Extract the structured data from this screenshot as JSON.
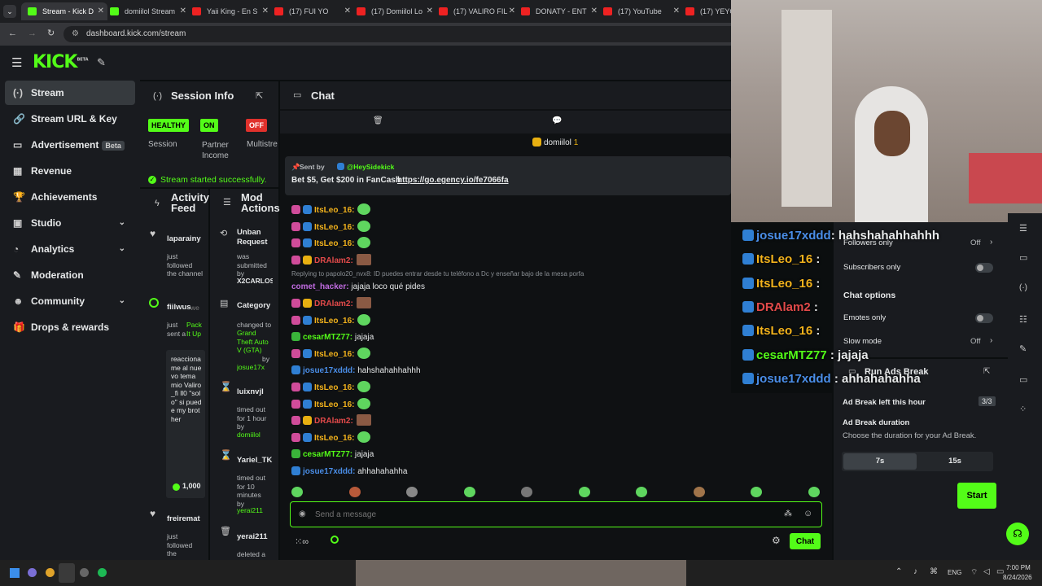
{
  "browser": {
    "tabs": [
      {
        "label": "Stream - Kick D",
        "color": "#53fc18"
      },
      {
        "label": "domiilol Stream",
        "color": "#53fc18"
      },
      {
        "label": "Yaii King - En S",
        "color": "#e22"
      },
      {
        "label": "(17) FUI YO",
        "color": "#e22"
      },
      {
        "label": "(17) Domiilol Lo",
        "color": "#e22"
      },
      {
        "label": "(17) VALIRO FIL",
        "color": "#e22"
      },
      {
        "label": "DONATY - ENT",
        "color": "#e22"
      },
      {
        "label": "(17) YouTube",
        "color": "#e22"
      },
      {
        "label": "(17) YEYO",
        "color": "#e22"
      }
    ],
    "url": "dashboard.kick.com/stream"
  },
  "brand": {
    "logo": "KICK",
    "beta": "BETA"
  },
  "nav": {
    "items": [
      {
        "label": "Stream",
        "icon": "signal-icon"
      },
      {
        "label": "Stream URL & Key",
        "icon": "link-icon"
      },
      {
        "label": "Advertisement",
        "icon": "ad-icon"
      },
      {
        "label": "Revenue",
        "icon": "dollar-icon"
      },
      {
        "label": "Achievements",
        "icon": "trophy-icon"
      },
      {
        "label": "Studio",
        "icon": "studio-icon"
      },
      {
        "label": "Analytics",
        "icon": "chart-icon"
      },
      {
        "label": "Moderation",
        "icon": "wrench-icon"
      },
      {
        "label": "Community",
        "icon": "people-icon"
      },
      {
        "label": "Drops & rewards",
        "icon": "gift-icon"
      }
    ],
    "beta_badge": "Beta"
  },
  "session": {
    "title": "Session Info",
    "pills": [
      {
        "text": "HEALTHY",
        "color": "#53fc18",
        "label": "Session"
      },
      {
        "text": "ON",
        "color": "#53fc18",
        "label": "Partner Income"
      },
      {
        "text": "OFF",
        "color": "#e0312c",
        "label": "Multistre"
      }
    ],
    "status": "Stream started successfully."
  },
  "activity": {
    "title": "Activity Feed",
    "items": [
      {
        "user": "laparainy",
        "text": "just followed the channel"
      },
      {
        "user": "fiilwus",
        "suffix": "we",
        "text": "just sent a",
        "pack": "Pack It Up",
        "quote": "reacciona me al nuevo tema mio Valiro_fi ll0 \"solo\" si puede my brother",
        "amount": "1,000"
      },
      {
        "user": "freiremat",
        "text": "just followed the"
      }
    ]
  },
  "mod": {
    "title": "Mod Actions",
    "items": [
      {
        "title": "Unban Request",
        "text": "was submitted by",
        "user": "X2CARLOS"
      },
      {
        "title": "Category",
        "text": "changed to",
        "game": "Grand Theft Auto V (GTA)",
        "by": "by",
        "user": "josue17x"
      },
      {
        "title": "luixnvjl",
        "text": "timed out for 1 hour by",
        "user": "domiilol"
      },
      {
        "title": "Yariel_TK",
        "text": "timed out for 10 minutes by",
        "user": "yerai211"
      },
      {
        "title": "yerai211",
        "text": "deleted a"
      }
    ]
  },
  "chat": {
    "title": "Chat",
    "channel": "domiilol",
    "viewers": "1",
    "pinned": {
      "sent_by": "Sent by",
      "sender": "@HeySidekick",
      "text": "Bet $5, Get $200 in FanCash",
      "link": "https://go.egency.io/fe7066fa"
    },
    "reply_line": "Replying to papolo20_nvx8: ID puedes entrar desde tu teléfono a Dc y enseñar bajo de la mesa porfa",
    "messages": [
      {
        "user": "ItsLeo_16:",
        "cls": "u-y",
        "text": "",
        "emote": "green",
        "b": [
          "b-pink",
          "b-blue"
        ]
      },
      {
        "user": "ItsLeo_16:",
        "cls": "u-y",
        "text": "",
        "emote": "green",
        "b": [
          "b-pink",
          "b-blue"
        ]
      },
      {
        "user": "ItsLeo_16:",
        "cls": "u-y",
        "text": "",
        "emote": "green",
        "b": [
          "b-pink",
          "b-blue"
        ]
      },
      {
        "user": "DRAlam2:",
        "cls": "u-r",
        "text": "",
        "emote": "brown",
        "b": [
          "b-pink",
          "b-gold"
        ]
      },
      {
        "user": "comet_hacker:",
        "cls": "u-p",
        "text": " jajaja loco qué pides",
        "emote": "",
        "b": []
      },
      {
        "user": "DRAlam2:",
        "cls": "u-r",
        "text": "",
        "emote": "brown",
        "b": [
          "b-pink",
          "b-gold"
        ]
      },
      {
        "user": "ItsLeo_16:",
        "cls": "u-y",
        "text": "",
        "emote": "green",
        "b": [
          "b-pink",
          "b-blue"
        ]
      },
      {
        "user": "cesarMTZ77:",
        "cls": "u-g",
        "text": " jajaja",
        "emote": "",
        "b": [
          "b-grn"
        ]
      },
      {
        "user": "ItsLeo_16:",
        "cls": "u-y",
        "text": "",
        "emote": "green",
        "b": [
          "b-pink",
          "b-blue"
        ]
      },
      {
        "user": "josue17xddd:",
        "cls": "u-b",
        "text": " hahshahahhahhh",
        "emote": "",
        "b": [
          "b-blue"
        ]
      },
      {
        "user": "ItsLeo_16:",
        "cls": "u-y",
        "text": "",
        "emote": "green",
        "b": [
          "b-pink",
          "b-blue"
        ]
      },
      {
        "user": "ItsLeo_16:",
        "cls": "u-y",
        "text": "",
        "emote": "green",
        "b": [
          "b-pink",
          "b-blue"
        ]
      },
      {
        "user": "DRAlam2:",
        "cls": "u-r",
        "text": "",
        "emote": "brown",
        "b": [
          "b-pink",
          "b-gold"
        ]
      },
      {
        "user": "ItsLeo_16:",
        "cls": "u-y",
        "text": "",
        "emote": "green",
        "b": [
          "b-pink",
          "b-blue"
        ]
      },
      {
        "user": "cesarMTZ77:",
        "cls": "u-g",
        "text": " jajaja",
        "emote": "",
        "b": [
          "b-grn"
        ]
      },
      {
        "user": "josue17xddd:",
        "cls": "u-b",
        "text": " ahhahahahha",
        "emote": "",
        "b": [
          "b-blue"
        ]
      }
    ],
    "input_placeholder": "Send a message",
    "send_label": "Chat"
  },
  "overlay": {
    "messages": [
      {
        "user": "josue17xddd",
        "text": ": hahshahahhahhh",
        "color": "#4a8ee8"
      },
      {
        "user": "ItsLeo_16",
        "text": " :",
        "color": "#f2b21c"
      },
      {
        "user": "ItsLeo_16",
        "text": " :",
        "color": "#f2b21c"
      },
      {
        "user": "DRAlam2",
        "text": " :",
        "color": "#e24a4a"
      },
      {
        "user": "ItsLeo_16",
        "text": " :",
        "color": "#f2b21c"
      },
      {
        "user": "cesarMTZ77",
        "text": " : jajaja",
        "color": "#53fc18"
      },
      {
        "user": "josue17xddd",
        "text": " : ahhahahahha",
        "color": "#4a8ee8"
      }
    ]
  },
  "chat_settings": {
    "followers_only": "Followers only",
    "followers_value": "Off",
    "subscribers_only": "Subscribers only",
    "chat_options": "Chat options",
    "emotes_only": "Emotes only",
    "slow_mode": "Slow mode",
    "slow_value": "Off"
  },
  "ads": {
    "title": "Run Ads Break",
    "left_label": "Ad Break left this hour",
    "left_value": "3/3",
    "duration_label": "Ad Break duration",
    "duration_desc": "Choose the duration for your Ad Break.",
    "opt1": "7s",
    "opt2": "15s",
    "start": "Start"
  },
  "taskbar": {
    "lang": "ENG",
    "time": "7:00 PM",
    "date": "8/24/2026"
  }
}
